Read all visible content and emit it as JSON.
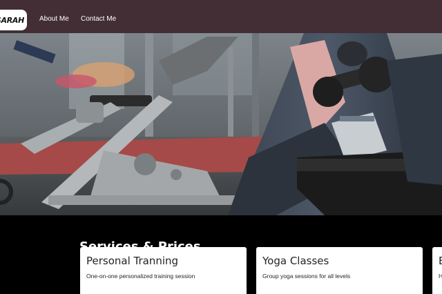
{
  "navbar": {
    "logo_text": "SARAH",
    "links": [
      {
        "label": "About Me"
      },
      {
        "label": "Contact Me"
      }
    ]
  },
  "hero": {
    "image": "gym-workout-dumbbell-photo"
  },
  "services": {
    "title": "Services & Prices",
    "cards": [
      {
        "title": "Personal Tranning",
        "description": "One-on-one personalized training session"
      },
      {
        "title": "Yoga Classes",
        "description": "Group yoga sessions for all levels"
      },
      {
        "title": "B",
        "description": "H"
      }
    ]
  },
  "colors": {
    "navbar_bg": "#432e36",
    "section_bg": "#000000",
    "card_bg": "#ffffff"
  }
}
